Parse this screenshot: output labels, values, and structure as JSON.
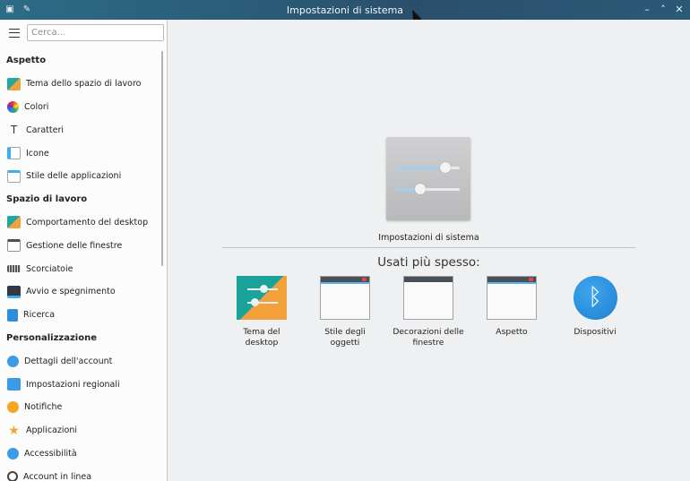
{
  "window": {
    "title": "Impostazioni di sistema"
  },
  "search": {
    "placeholder": "Cerca..."
  },
  "sidebar": {
    "groups": [
      {
        "title": "Aspetto",
        "items": [
          {
            "label": "Tema dello spazio di lavoro",
            "icon": "workspace-theme-icon"
          },
          {
            "label": "Colori",
            "icon": "colors-icon"
          },
          {
            "label": "Caratteri",
            "icon": "fonts-icon"
          },
          {
            "label": "Icone",
            "icon": "icons-icon"
          },
          {
            "label": "Stile delle applicazioni",
            "icon": "app-style-icon"
          }
        ]
      },
      {
        "title": "Spazio di lavoro",
        "items": [
          {
            "label": "Comportamento del desktop",
            "icon": "desktop-behavior-icon"
          },
          {
            "label": "Gestione delle finestre",
            "icon": "window-management-icon"
          },
          {
            "label": "Scorciatoie",
            "icon": "keyboard-icon"
          },
          {
            "label": "Avvio e spegnimento",
            "icon": "startup-shutdown-icon"
          },
          {
            "label": "Ricerca",
            "icon": "search-doc-icon"
          }
        ]
      },
      {
        "title": "Personalizzazione",
        "items": [
          {
            "label": "Dettagli dell'account",
            "icon": "account-icon"
          },
          {
            "label": "Impostazioni regionali",
            "icon": "regional-icon"
          },
          {
            "label": "Notifiche",
            "icon": "notifications-icon"
          },
          {
            "label": "Applicazioni",
            "icon": "applications-icon"
          },
          {
            "label": "Accessibilità",
            "icon": "accessibility-icon"
          },
          {
            "label": "Account in linea",
            "icon": "online-accounts-icon"
          }
        ]
      }
    ]
  },
  "main": {
    "hero_label": "Impostazioni di sistema",
    "frequent_title": "Usati più spesso:",
    "tiles": [
      {
        "label": "Tema del desktop",
        "icon": "desktop-theme-icon"
      },
      {
        "label": "Stile degli oggetti",
        "icon": "widget-style-icon"
      },
      {
        "label": "Decorazioni delle finestre",
        "icon": "window-decorations-icon"
      },
      {
        "label": "Aspetto",
        "icon": "appearance-icon"
      },
      {
        "label": "Dispositivi",
        "icon": "bluetooth-icon"
      }
    ]
  },
  "colors": {
    "accent": "#3daee9",
    "titlebar": "#2a5d78"
  }
}
